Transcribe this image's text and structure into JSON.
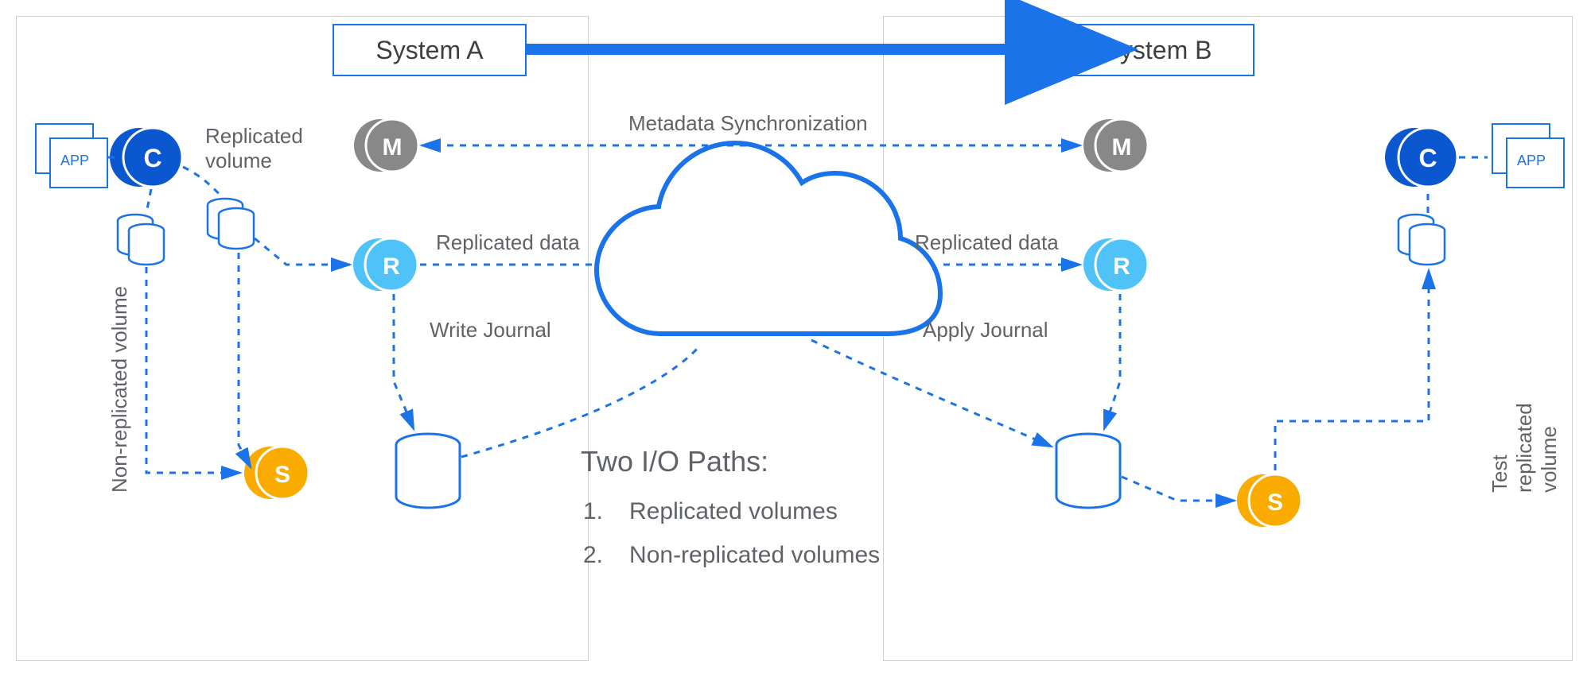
{
  "systems": {
    "a": "System A",
    "b": "System B"
  },
  "app": {
    "label": "APP"
  },
  "nodes": {
    "c": "C",
    "m": "M",
    "r": "R",
    "s": "S"
  },
  "labels": {
    "replicated_volume": "Replicated\nvolume",
    "metadata_sync": "Metadata Synchronization",
    "replicated_data_left": "Replicated data",
    "replicated_data_right": "Replicated data",
    "write_journal": "Write Journal",
    "apply_journal": "Apply Journal",
    "non_replicated_volume": "Non-replicated volume",
    "test_replicated_volume": "Test replicated volume"
  },
  "iopaths": {
    "title": "Two I/O Paths:",
    "items": [
      "Replicated volumes",
      "Non-replicated volumes"
    ]
  },
  "colors": {
    "blue": "#1a73e8",
    "darkblue": "#0b57d0",
    "lightblue": "#4fc3f7",
    "gray": "#888888",
    "orange": "#f9ab00",
    "white": "#ffffff"
  }
}
